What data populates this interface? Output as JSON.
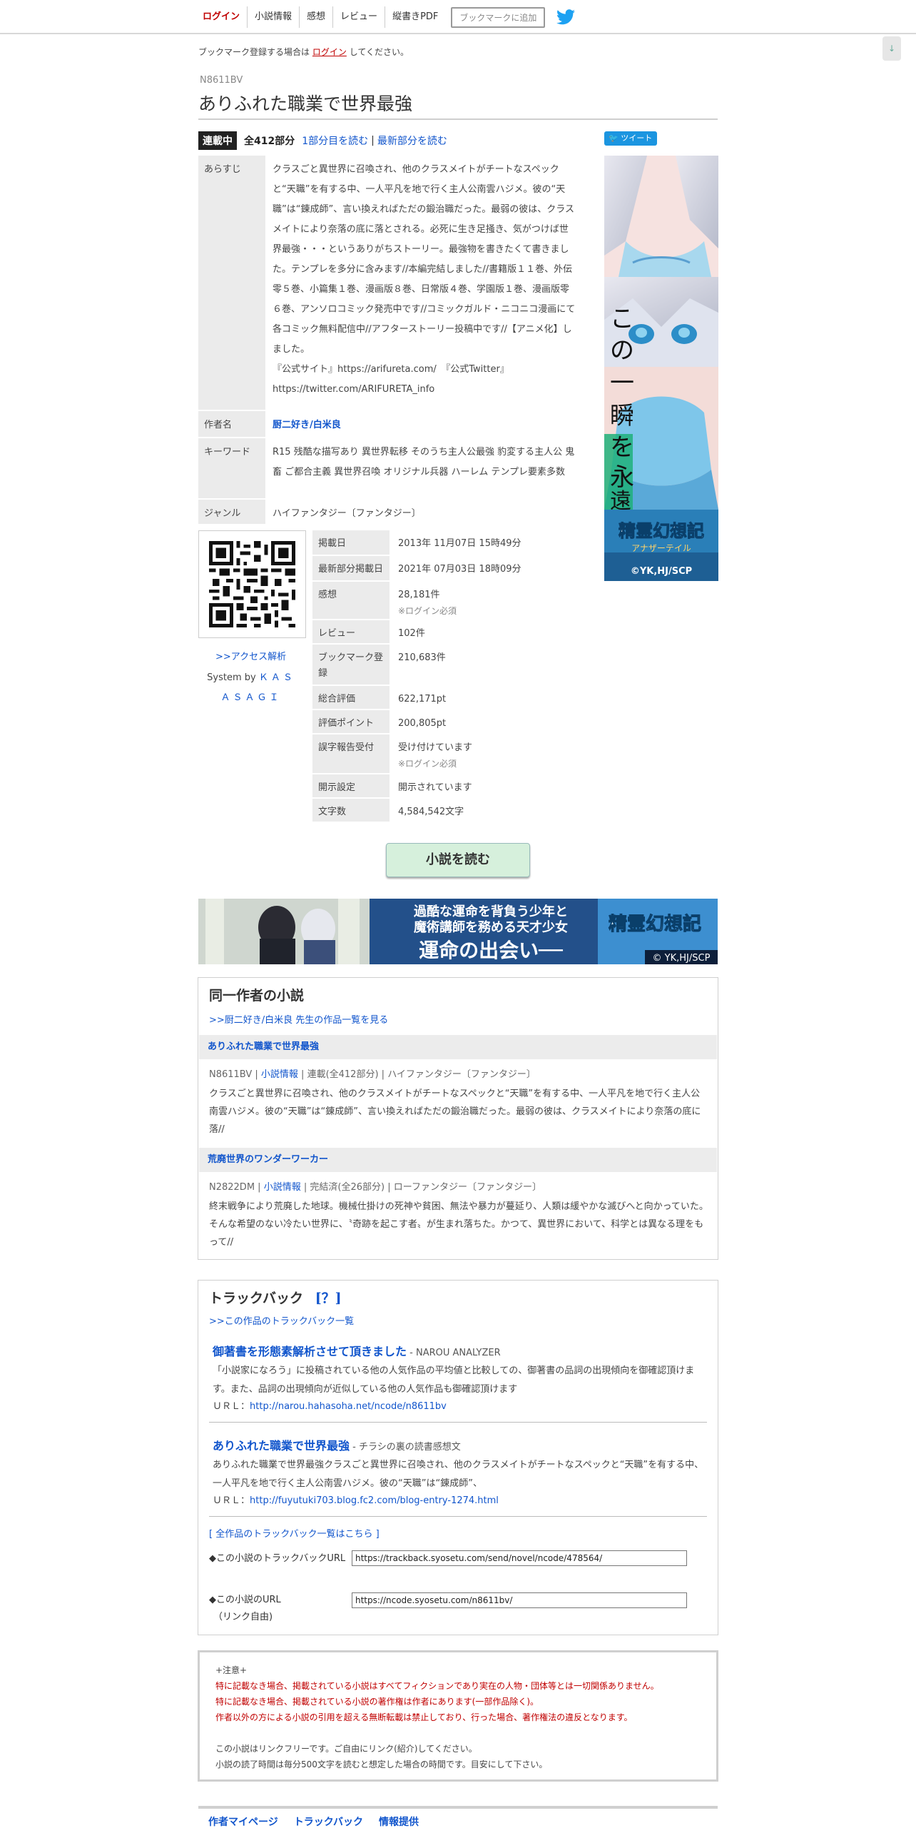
{
  "header": {
    "nav": [
      "ログイン",
      "小説情報",
      "感想",
      "レビュー",
      "縦書きPDF"
    ],
    "bookmark_button": "ブックマークに追加"
  },
  "notice": {
    "before": "ブックマーク登録する場合は",
    "link": "ログイン",
    "after": "してください。"
  },
  "pager_button": "↓",
  "novel": {
    "ncode": "N8611BV",
    "title": "ありふれた職業で世界最強",
    "status": "連載中",
    "count": "全412部分",
    "read_first": "1部分目を読む",
    "read_latest": "最新部分を読む",
    "sep": "|"
  },
  "info": {
    "synopsis_label": "あらすじ",
    "synopsis": "クラスごと異世界に召喚され、他のクラスメイトがチートなスペックと“天職”を有する中、一人平凡を地で行く主人公南雲ハジメ。彼の“天職”は“錬成師”、言い換えればただの鍛治職だった。最弱の彼は、クラスメイトにより奈落の底に落とされる。必死に生き足掻き、気がつけば世界最強・・・というありがちストーリー。最強物を書きたくて書きました。テンプレを多分に含みます//本編完結しました//書籍版１１巻、外伝零５巻、小篇集１巻、漫画版８巻、日常版４巻、学園版１巻、漫画版零６巻、アンソロコミック発売中です//コミックガルド・ニコニコ漫画にて各コミック無料配信中//アフターストーリー投稿中です//【アニメ化】しました。",
    "synopsis_link1": "『公式サイト』https://arifureta.com/　『公式Twitter』",
    "synopsis_link2": "https://twitter.com/ARIFURETA_info",
    "author_label": "作者名",
    "author": "厨二好き/白米良",
    "keyword_label": "キーワード",
    "keywords": "R15 残酷な描写あり 異世界転移 そのうち主人公最強 豹変する主人公 鬼畜 ご都合主義 異世界召喚 オリジナル兵器 ハーレム テンプレ要素多数",
    "genre_label": "ジャンル",
    "genre": "ハイファンタジー〔ファンタジー〕"
  },
  "access": {
    "link": ">>アクセス解析",
    "system_by": "System by",
    "system_name": "ＫＡＳＡＳＡＧＩ"
  },
  "stats": [
    {
      "label": "掲載日",
      "value": "2013年 11月07日 15時49分",
      "sub": ""
    },
    {
      "label": "最新部分掲載日",
      "value": "2021年 07月03日 18時09分",
      "sub": ""
    },
    {
      "label": "感想",
      "value": "28,181件",
      "sub": "※ログイン必須"
    },
    {
      "label": "レビュー",
      "value": "102件",
      "sub": ""
    },
    {
      "label": "ブックマーク登録",
      "value": "210,683件",
      "sub": ""
    },
    {
      "label": "総合評価",
      "value": "622,171pt",
      "sub": ""
    },
    {
      "label": "評価ポイント",
      "value": "200,805pt",
      "sub": ""
    },
    {
      "label": "誤字報告受付",
      "value": "受け付けています",
      "sub": "※ログイン必須"
    },
    {
      "label": "開示設定",
      "value": "開示されています",
      "sub": ""
    },
    {
      "label": "文字数",
      "value": "4,584,542文字",
      "sub": ""
    }
  ],
  "tweet_button": "ツイート",
  "side_ad": {
    "tagline": "この一瞬を永遠に",
    "logo": "精霊幻想記",
    "logo_sub": "アナザーテイル",
    "copyright": "©YK,HJ/SCP"
  },
  "read_button": "小説を読む",
  "banner": {
    "line1": "過酷な運命を背負う少年と",
    "line2": "魔術講師を務める天才少女",
    "line3": "運命の出会い──",
    "logo": "精霊幻想記",
    "copyright": "© YK,HJ/SCP"
  },
  "same_author": {
    "title": "同一作者の小説",
    "more": ">>厨二好き/白米良 先生の作品一覧を見る",
    "novels": [
      {
        "title": "ありふれた職業で世界最強",
        "ncode": "N8611BV",
        "info_link": "小説情報",
        "status": "連載(全412部分)",
        "genre": "ハイファンタジー〔ファンタジー〕",
        "desc": "クラスごと異世界に召喚され、他のクラスメイトがチートなスペックと“天職”を有する中、一人平凡を地で行く主人公南雲ハジメ。彼の“天職”は“錬成師”、言い換えればただの鍛治職だった。最弱の彼は、クラスメイトにより奈落の底に落//"
      },
      {
        "title": "荒廃世界のワンダーワーカー",
        "ncode": "N2822DM",
        "info_link": "小説情報",
        "status": "完結済(全26部分)",
        "genre": "ローファンタジー〔ファンタジー〕",
        "desc": "終末戦争により荒廃した地球。機械仕掛けの死神や貧困、無法や暴力が蔓延り、人類は緩やかな滅びへと向かっていた。そんな希望のない冷たい世界に、〝奇跡を起こす者〟が生まれ落ちた。かつて、異世界において、科学とは異なる理をもって//"
      }
    ]
  },
  "trackback": {
    "title": "トラックバック",
    "help": "[？]",
    "more": ">>この作品のトラックバック一覧",
    "entries": [
      {
        "title": "御著書を形態素解析させて頂きました",
        "source": " - NAROU ANALYZER",
        "desc": "「小説家になろう」に投稿されている他の人気作品の平均値と比較しての、御著書の品詞の出現傾向を御確認頂けます。また、品詞の出現傾向が近似している他の人気作品も御確認頂けます",
        "url_label": "ＵＲＬ：",
        "url": "http://narou.hahasoha.net/ncode/n8611bv"
      },
      {
        "title": "ありふれた職業で世界最強",
        "source": " - チラシの裏の読書感想文",
        "desc": "ありふれた職業で世界最強クラスごと異世界に召喚され、他のクラスメイトがチートなスペックと“天職”を有する中、一人平凡を地で行く主人公南雲ハジメ。彼の“天職”は“錬成師”、",
        "url_label": "ＵＲＬ：",
        "url": "http://fuyutuki703.blog.fc2.com/blog-entry-1274.html"
      }
    ],
    "all_link": "[ 全作品のトラックバック一覧はこちら ]",
    "tb_url_label": "◆この小説のトラックバックURL",
    "tb_url": "https://trackback.syosetu.com/send/novel/ncode/478564/",
    "novel_url_label": "◆この小説のURL",
    "novel_url_note": "（リンク自由)",
    "novel_url": "https://ncode.syosetu.com/n8611bv/"
  },
  "caution": {
    "head": "+注意+",
    "red": [
      "特に記載なき場合、掲載されている小説はすべてフィクションであり実在の人物・団体等とは一切関係ありません。",
      "特に記載なき場合、掲載されている小説の著作権は作者にあります(一部作品除く)。",
      "作者以外の方による小説の引用を超える無断転載は禁止しており、行った場合、著作権法の違反となります。"
    ],
    "plain": [
      "この小説はリンクフリーです。ご自由にリンク(紹介)してください。",
      "小説の読了時間は毎分500文字を読むと想定した場合の時間です。目安にして下さい。"
    ]
  },
  "footer": [
    "作者マイページ",
    "トラックバック",
    "情報提供"
  ],
  "colors": {
    "accent": "#1155cc",
    "login_red": "#c00000",
    "read_button": "#d6f0dc",
    "twitter": "#1b95e0"
  }
}
